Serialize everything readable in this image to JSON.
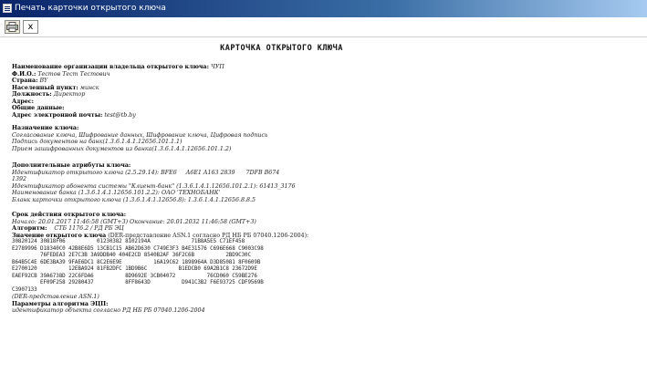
{
  "window": {
    "title": "Печать карточки открытого ключа",
    "icon": "document-icon"
  },
  "toolbar": {
    "print_icon": "printer-icon",
    "close_label": "x"
  },
  "card": {
    "title": "КАРТОЧКА ОТКРЫТОГО КЛЮЧА",
    "owner": [
      {
        "label": "Наименование организации владельца открытого ключа:",
        "value": "ЧУП"
      },
      {
        "label": "Ф.И.О.:",
        "value": "Тестов Тест Тестович"
      },
      {
        "label": "Страна:",
        "value": "BY"
      },
      {
        "label": "Населенный пункт:",
        "value": "минск"
      },
      {
        "label": "Должность:",
        "value": "Директор"
      },
      {
        "label": "Адрес:",
        "value": ""
      },
      {
        "label": "Общие данные:",
        "value": ""
      },
      {
        "label": "Адрес электронной почты:",
        "value": "test@tb.by"
      }
    ],
    "purpose": {
      "heading": "Назначение ключа:",
      "lines": [
        "Согласование ключа, Шифрование данных, Шифрование ключа, Цифровая подпись",
        "Подпись документов на банк(1.3.6.1.4.1.12656.101.1.1)",
        "Прием зашифрованных документов из банка(1.3.6.1.4.1.12656.101.1.2)"
      ]
    },
    "attributes": {
      "heading": "Дополнительные атрибуты ключа:",
      "lines": [
        "Идентификатор открытого ключа (2.5.29.14): BFE6     A6E1 A163 2839      7DFB B674",
        "1392",
        "Идентификатор абонента системы \"Клиент-банк\" (1.3.6.1.4.1.12656.101.2.1): 61413_3176",
        "Наименование банка (1.3.6.1.4.1.12656.101.2.2): ОАО 'ТЕХНОБАНК'",
        "Бланк карточки открытого ключа (1.3.6.1.4.1.12656.8): 1.3.6.1.4.1.12656.8.8.5"
      ]
    },
    "validity": {
      "heading": "Срок действия открытого ключа:",
      "line": "Начало: 20.01.2017 11:46:58 (GMT+3) Окончание: 20.01.2032 11:46:58 (GMT+3)"
    },
    "algorithm": {
      "label": "Алгоритм:",
      "value": "СТБ 1176.2 / РД РБ ЭЦ"
    },
    "key_value": {
      "label": "Значение открытого ключа",
      "suffix": "(DER-представление ASN.1 согласно РД НБ РБ 07040.1206-2004):",
      "rows": [
        "30820124 30818F06          01230382 8102194A             71B8A5E5 C71EF458",
        "E2789996 D18340C0 42B8E6D5 13CB1C15 AB62D630 C749E3F3 B4E31576 C696E668 C9003C98",
        "         76FEDEA3 2E7C3B 3A9DDB40 404E2CD 8540B2AF 36F2C6B          2BD9C30C",
        "B64B5C4E 6DE3BA39 9FAE6DC1 8C2E6E9E          16A19C62 1898964A D3D85081 8F0609B",
        "E2700120          12EBA924 81FB2DFC 1BD9B6C          B1EDCB0 69A2B1C8 23672D9E",
        "EAEF92CB 39A6738D 22C6FDA6          8D9692E 3CB04072          76CD060 C59BE276",
        "         EF09F258 29280437          8FF8643D          D941C3B2 F6E93725 CDF9569B",
        "C3907133"
      ],
      "footer": "(DER-представление ASN.1)"
    },
    "params": {
      "heading": "Параметры алгоритма ЭЦП:",
      "line": "идентификатор объекта согласно РД НБ РБ 07040.1206-2004"
    }
  }
}
